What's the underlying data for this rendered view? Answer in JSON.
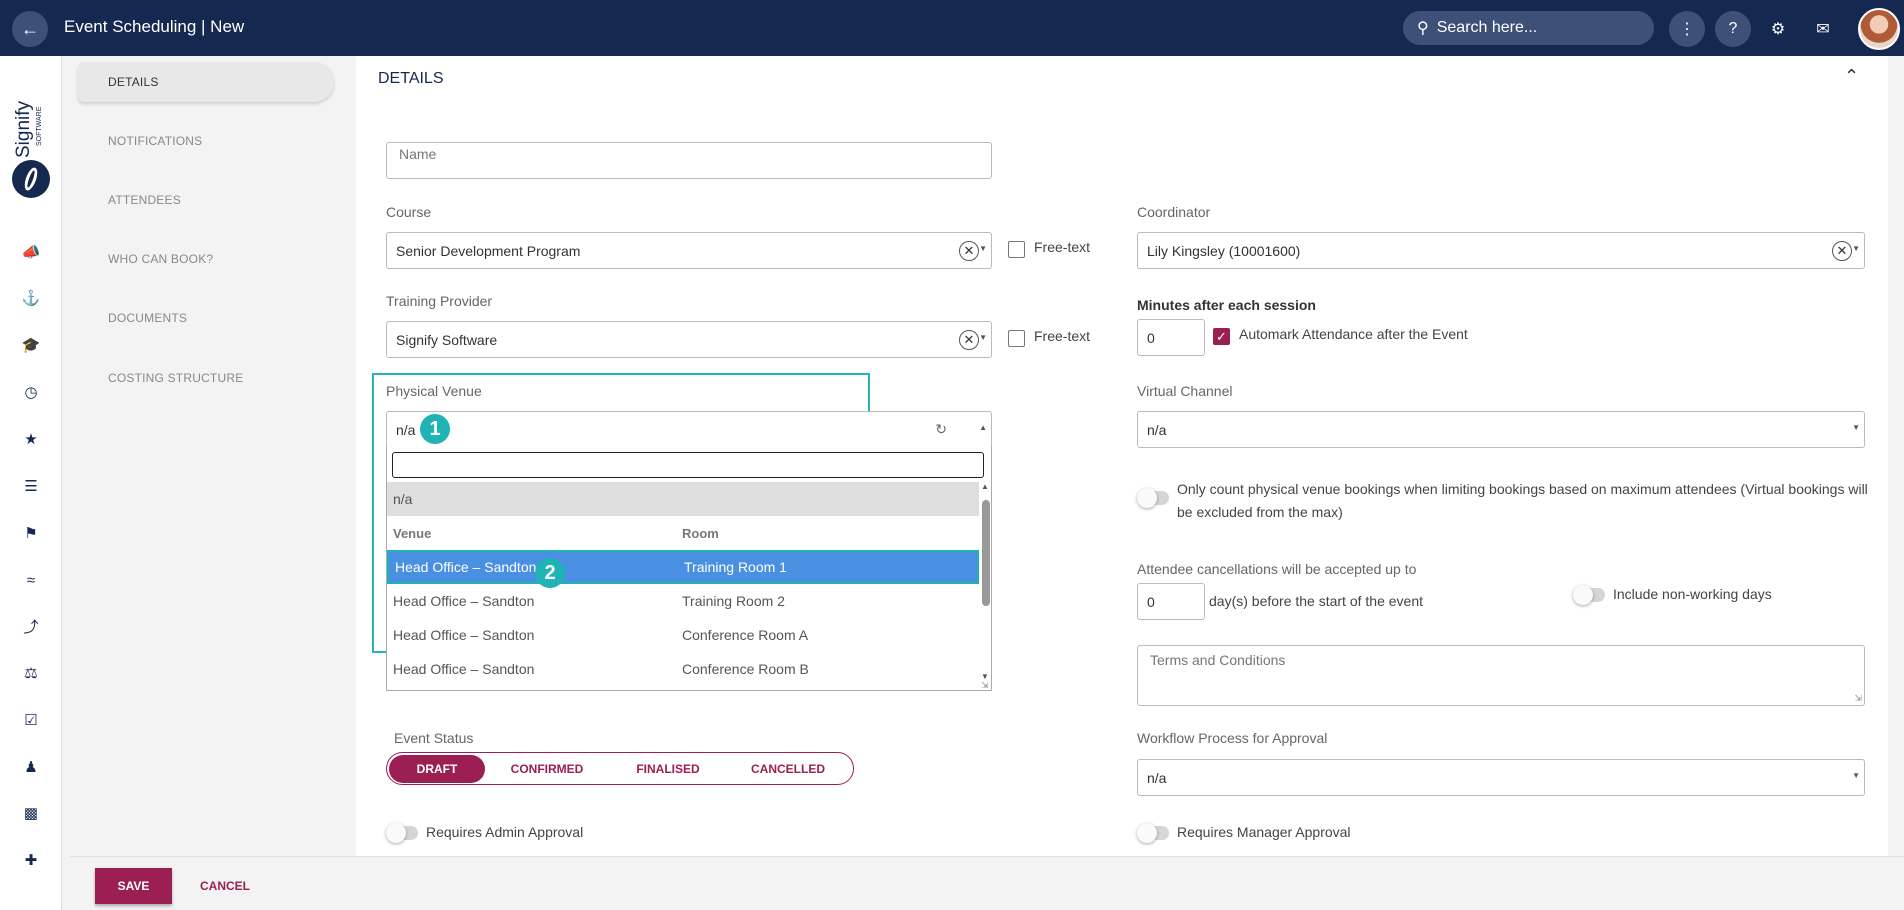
{
  "header": {
    "title": "Event Scheduling | New",
    "search_placeholder": "Search here..."
  },
  "brand": {
    "logo_text": "Signify",
    "logo_sub": "SOFTWARE"
  },
  "rail_icons": [
    "megaphone-icon",
    "podium-icon",
    "graduation-cap-icon",
    "speedometer-icon",
    "star-icon",
    "sliders-icon",
    "signpost-icon",
    "handshake-icon",
    "route-icon",
    "scales-icon",
    "calendar-check-icon",
    "user-key-icon",
    "laptop-icon",
    "user-plus-icon"
  ],
  "sections": [
    {
      "label": "DETAILS",
      "active": true
    },
    {
      "label": "NOTIFICATIONS"
    },
    {
      "label": "ATTENDEES"
    },
    {
      "label": "WHO CAN BOOK?"
    },
    {
      "label": "DOCUMENTS"
    },
    {
      "label": "COSTING STRUCTURE"
    }
  ],
  "form": {
    "section_title": "DETAILS",
    "name_label": "Name",
    "course_label": "Course",
    "course_value": "Senior Development Program",
    "free_text_label": "Free-text",
    "provider_label": "Training Provider",
    "provider_value": "Signify Software",
    "venue_label": "Physical Venue",
    "venue_value": "n/a",
    "coordinator_label": "Coordinator",
    "coordinator_value": "Lily Kingsley (10001600)",
    "minutes_label": "Minutes after each session",
    "minutes_value": "0",
    "automark_label": "Automark Attendance after the Event",
    "virtual_label": "Virtual Channel",
    "virtual_value": "n/a",
    "only_count_text": "Only count physical venue bookings when limiting bookings based on maximum attendees (Virtual bookings will be excluded from the max)",
    "cancellations_label": "Attendee cancellations will be accepted up to",
    "cancellations_value": "0",
    "days_label": "day(s) before the start of the event",
    "non_working_label": "Include non-working days",
    "terms_label": "Terms and Conditions",
    "event_status_label": "Event Status",
    "statuses": [
      "DRAFT",
      "CONFIRMED",
      "FINALISED",
      "CANCELLED"
    ],
    "workflow_label": "Workflow Process for Approval",
    "workflow_value": "n/a",
    "admin_approval_label": "Requires Admin Approval",
    "manager_approval_label": "Requires Manager Approval"
  },
  "venue_dropdown": {
    "na_option": "n/a",
    "col_venue": "Venue",
    "col_room": "Room",
    "rows": [
      {
        "venue": "Head Office – Sandton",
        "room": "Training Room 1"
      },
      {
        "venue": "Head Office – Sandton",
        "room": "Training Room 2"
      },
      {
        "venue": "Head Office – Sandton",
        "room": "Conference Room A"
      },
      {
        "venue": "Head Office – Sandton",
        "room": "Conference Room B"
      }
    ],
    "badge_1": "1",
    "badge_2": "2"
  },
  "footer": {
    "save_label": "SAVE",
    "cancel_label": "CANCEL"
  },
  "colors": {
    "header_bg": "#152850",
    "accent": "#9c1f54",
    "highlight": "#26b5b5",
    "selected_row": "#4a90e2"
  }
}
